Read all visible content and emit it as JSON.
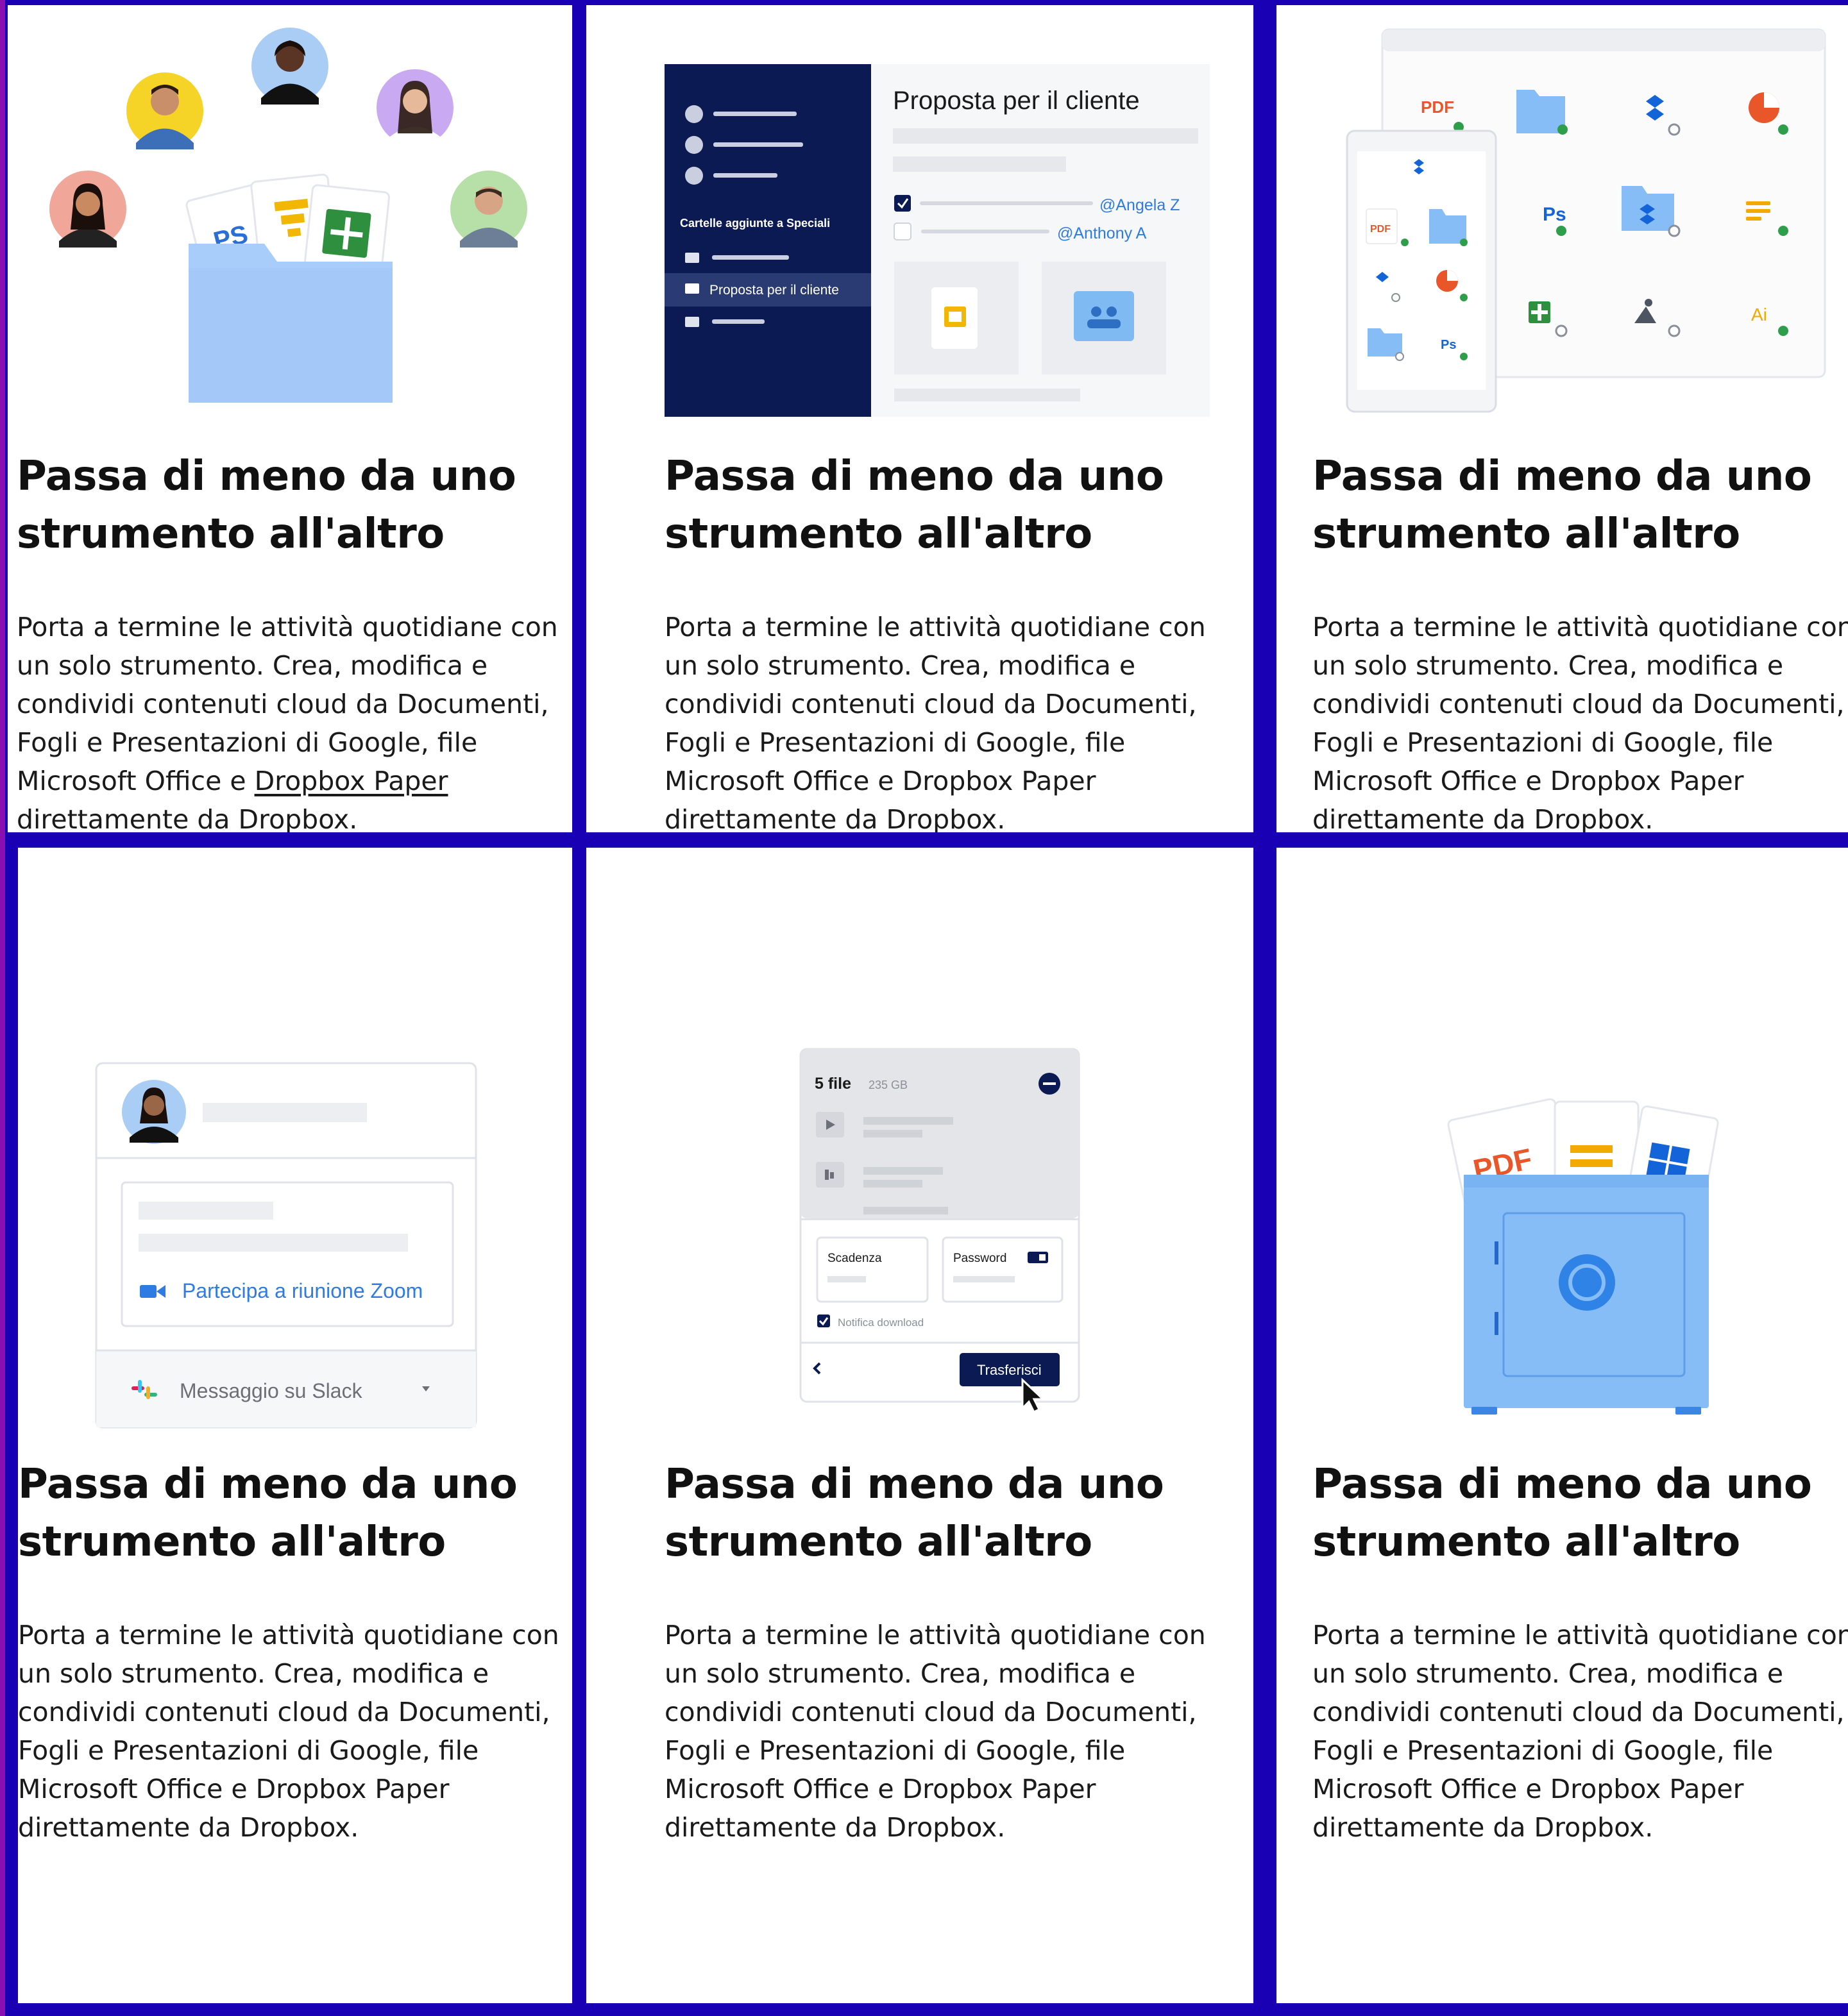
{
  "cards": [
    {
      "title_line1": "Passa di meno da uno",
      "title_line2": "strumento all'altro",
      "body": {
        "l1": "Porta a termine le attività quotidiane con",
        "l2": "un solo strumento. Crea, modifica e",
        "l3": "condividi contenuti cloud da Documenti,",
        "l4": "Fogli e Presentazioni di Google, file",
        "l5_pre": "Microsoft Office e ",
        "l5_link": "Dropbox Paper",
        "l6": "direttamente da Dropbox."
      },
      "illustration": {
        "file_label": "PS"
      }
    },
    {
      "title_line1": "Passa di meno da uno",
      "title_line2": "strumento all'altro",
      "body": {
        "l1": "Porta a termine le attività quotidiane con",
        "l2": "un solo strumento. Crea, modifica e",
        "l3": "condividi contenuti cloud da Documenti,",
        "l4": "Fogli e Presentazioni di Google, file",
        "l5_pre": "Microsoft Office e Dropbox Paper",
        "l6": "direttamente da Dropbox."
      },
      "illustration": {
        "doc_title": "Proposta per il cliente",
        "sidebar_section": "Cartelle aggiunte a Speciali",
        "sidebar_selected": "Proposta per il cliente",
        "mention_1": "@Angela Z",
        "mention_2": "@Anthony A"
      }
    },
    {
      "title_line1": "Passa di meno da uno",
      "title_line2": "strumento all'altro",
      "body": {
        "l1": "Porta a termine le attività quotidiane con",
        "l2": "un solo strumento. Crea, modifica e",
        "l3": "condividi contenuti cloud da Documenti,",
        "l4": "Fogli e Presentazioni di Google, file",
        "l5_pre": "Microsoft Office e Dropbox Paper",
        "l6": "direttamente da Dropbox."
      },
      "illustration": {
        "pdf": "PDF",
        "ps": "Ps",
        "ai": "Ai"
      }
    },
    {
      "title_line1": "Passa di meno da uno",
      "title_line2": "strumento all'altro",
      "body": {
        "l1": "Porta a termine le attività quotidiane con",
        "l2": "un solo strumento. Crea, modifica e",
        "l3": "condividi contenuti cloud da Documenti,",
        "l4": "Fogli e Presentazioni di Google, file",
        "l5_pre": "Microsoft Office e Dropbox Paper",
        "l6": "direttamente da Dropbox."
      },
      "illustration": {
        "zoom_label": "Partecipa a riunione Zoom",
        "slack_label": "Messaggio su Slack"
      }
    },
    {
      "title_line1": "Passa di meno da uno",
      "title_line2": "strumento all'altro",
      "body": {
        "l1": "Porta a termine le attività quotidiane con",
        "l2": "un solo strumento. Crea, modifica e",
        "l3": "condividi contenuti cloud da Documenti,",
        "l4": "Fogli e Presentazioni di Google, file",
        "l5_pre": "Microsoft Office e Dropbox Paper",
        "l6": "direttamente da Dropbox."
      },
      "illustration": {
        "file_count": "5 file",
        "file_size": "235 GB",
        "expiry_label": "Scadenza",
        "password_label": "Password",
        "notify_label": "Notifica download",
        "transfer_button": "Trasferisci"
      }
    },
    {
      "title_line1": "Passa di meno da uno",
      "title_line2": "strumento all'altro",
      "body": {
        "l1": "Porta a termine le attività quotidiane con",
        "l2": "un solo strumento. Crea, modifica e",
        "l3": "condividi contenuti cloud da Documenti,",
        "l4": "Fogli e Presentazioni di Google, file",
        "l5_pre": "Microsoft Office e Dropbox Paper",
        "l6": "direttamente da Dropbox."
      },
      "illustration": {
        "pdf": "PDF"
      }
    }
  ],
  "colors": {
    "background": "#1a00b5",
    "left_accent": "#8a0fb0",
    "navy": "#0b1a52",
    "folder_blue": "#a9cdfa",
    "safe_blue": "#86bdf7",
    "link_blue": "#2d7be3"
  }
}
